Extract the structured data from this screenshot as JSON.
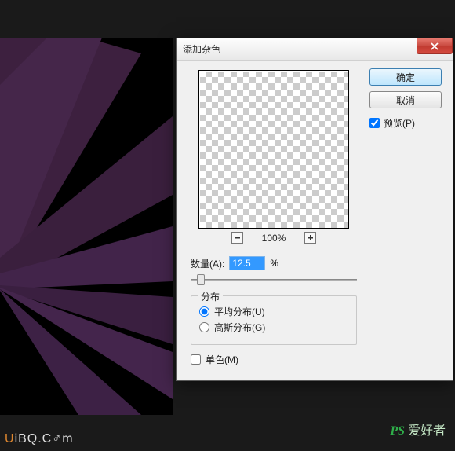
{
  "dialog": {
    "title": "添加杂色",
    "ok_label": "确定",
    "cancel_label": "取消",
    "preview_checkbox_label": "预览(P)",
    "zoom_pct": "100%",
    "amount_label": "数量(A):",
    "amount_value": "12.5",
    "amount_unit": "%",
    "distribution": {
      "legend": "分布",
      "uniform_label": "平均分布(U)",
      "gaussian_label": "高斯分布(G)"
    },
    "mono_label": "单色(M)"
  },
  "watermark": {
    "text_prefix": "U",
    "text_rest": "iBQ.C♂m"
  },
  "watermark2": {
    "ps": "PS",
    "txt": " 爱好者"
  }
}
